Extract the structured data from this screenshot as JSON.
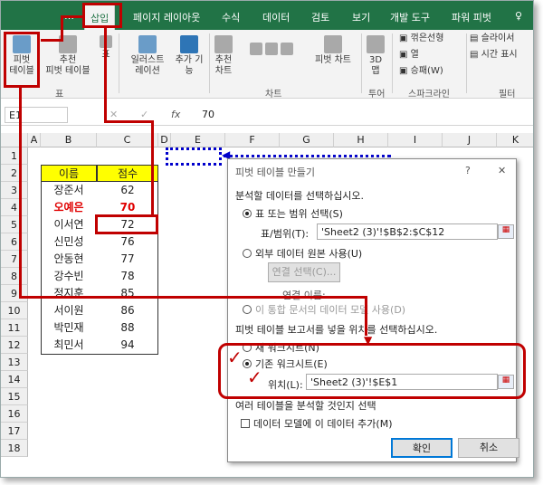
{
  "ribbon_tabs": [
    "삽입",
    "페이지 레이아웃",
    "수식",
    "데이터",
    "검토",
    "보기",
    "개발 도구",
    "파워 피벗"
  ],
  "ribbon": {
    "pivot_btn": "피벗\n테이블",
    "rec_pivot_btn": "추천\n피벗 테이블",
    "table_btn": "표",
    "group_table": "표",
    "illus_btn": "일러스트\n레이션",
    "addins_btn": "추가 기\n능",
    "rec_chart_btn": "추천\n차트",
    "pivot_chart_btn": "피벗 차트",
    "map3d_btn": "3D\n맵",
    "group_chart": "차트",
    "group_tour": "투어",
    "spark_line": "꺾은선형",
    "spark_col": "열",
    "spark_wl": "승패(W)",
    "group_spark": "스파크라인",
    "slicer": "슬라이서",
    "timeline": "시간 표시",
    "group_filter": "필터"
  },
  "formula_bar": {
    "name_box": "E1",
    "fx": "fx",
    "value": "70"
  },
  "columns": [
    "A",
    "B",
    "C",
    "D",
    "E",
    "F",
    "G",
    "H",
    "I",
    "J",
    "K"
  ],
  "rows": [
    "1",
    "2",
    "3",
    "4",
    "5",
    "6",
    "7",
    "8",
    "9",
    "10",
    "11",
    "12",
    "13",
    "14",
    "15",
    "16",
    "17",
    "18"
  ],
  "table": {
    "header": [
      "이름",
      "점수"
    ],
    "rows": [
      [
        "장준서",
        "62"
      ],
      [
        "오예은",
        "70"
      ],
      [
        "이서연",
        "72"
      ],
      [
        "신민성",
        "76"
      ],
      [
        "안동현",
        "77"
      ],
      [
        "강수빈",
        "78"
      ],
      [
        "정지훈",
        "85"
      ],
      [
        "서이원",
        "86"
      ],
      [
        "박민재",
        "88"
      ],
      [
        "최민서",
        "94"
      ]
    ]
  },
  "dialog": {
    "title": "피벗 테이블 만들기",
    "help": "?",
    "close": "✕",
    "section1": "분석할 데이터를 선택하십시오.",
    "opt_range": "표 또는 범위 선택(S)",
    "range_label": "표/범위(T):",
    "range_value": "'Sheet2 (3)'!$B$2:$C$12",
    "opt_external": "외부 데이터 원본 사용(U)",
    "choose_conn": "연결 선택(C)...",
    "conn_name": "연결 이름:",
    "opt_model": "이 통합 문서의 데이터 모델 사용(D)",
    "section2": "피벗 테이블 보고서를 넣을 위치를 선택하십시오.",
    "opt_new": "새 워크시트(N)",
    "opt_existing": "기존 워크시트(E)",
    "loc_label": "위치(L):",
    "loc_value": "'Sheet2 (3)'!$E$1",
    "section3": "여러 테이블을 분석할 것인지 선택",
    "add_model": "데이터 모델에 이 데이터 추가(M)",
    "ok": "확인",
    "cancel": "취소"
  }
}
